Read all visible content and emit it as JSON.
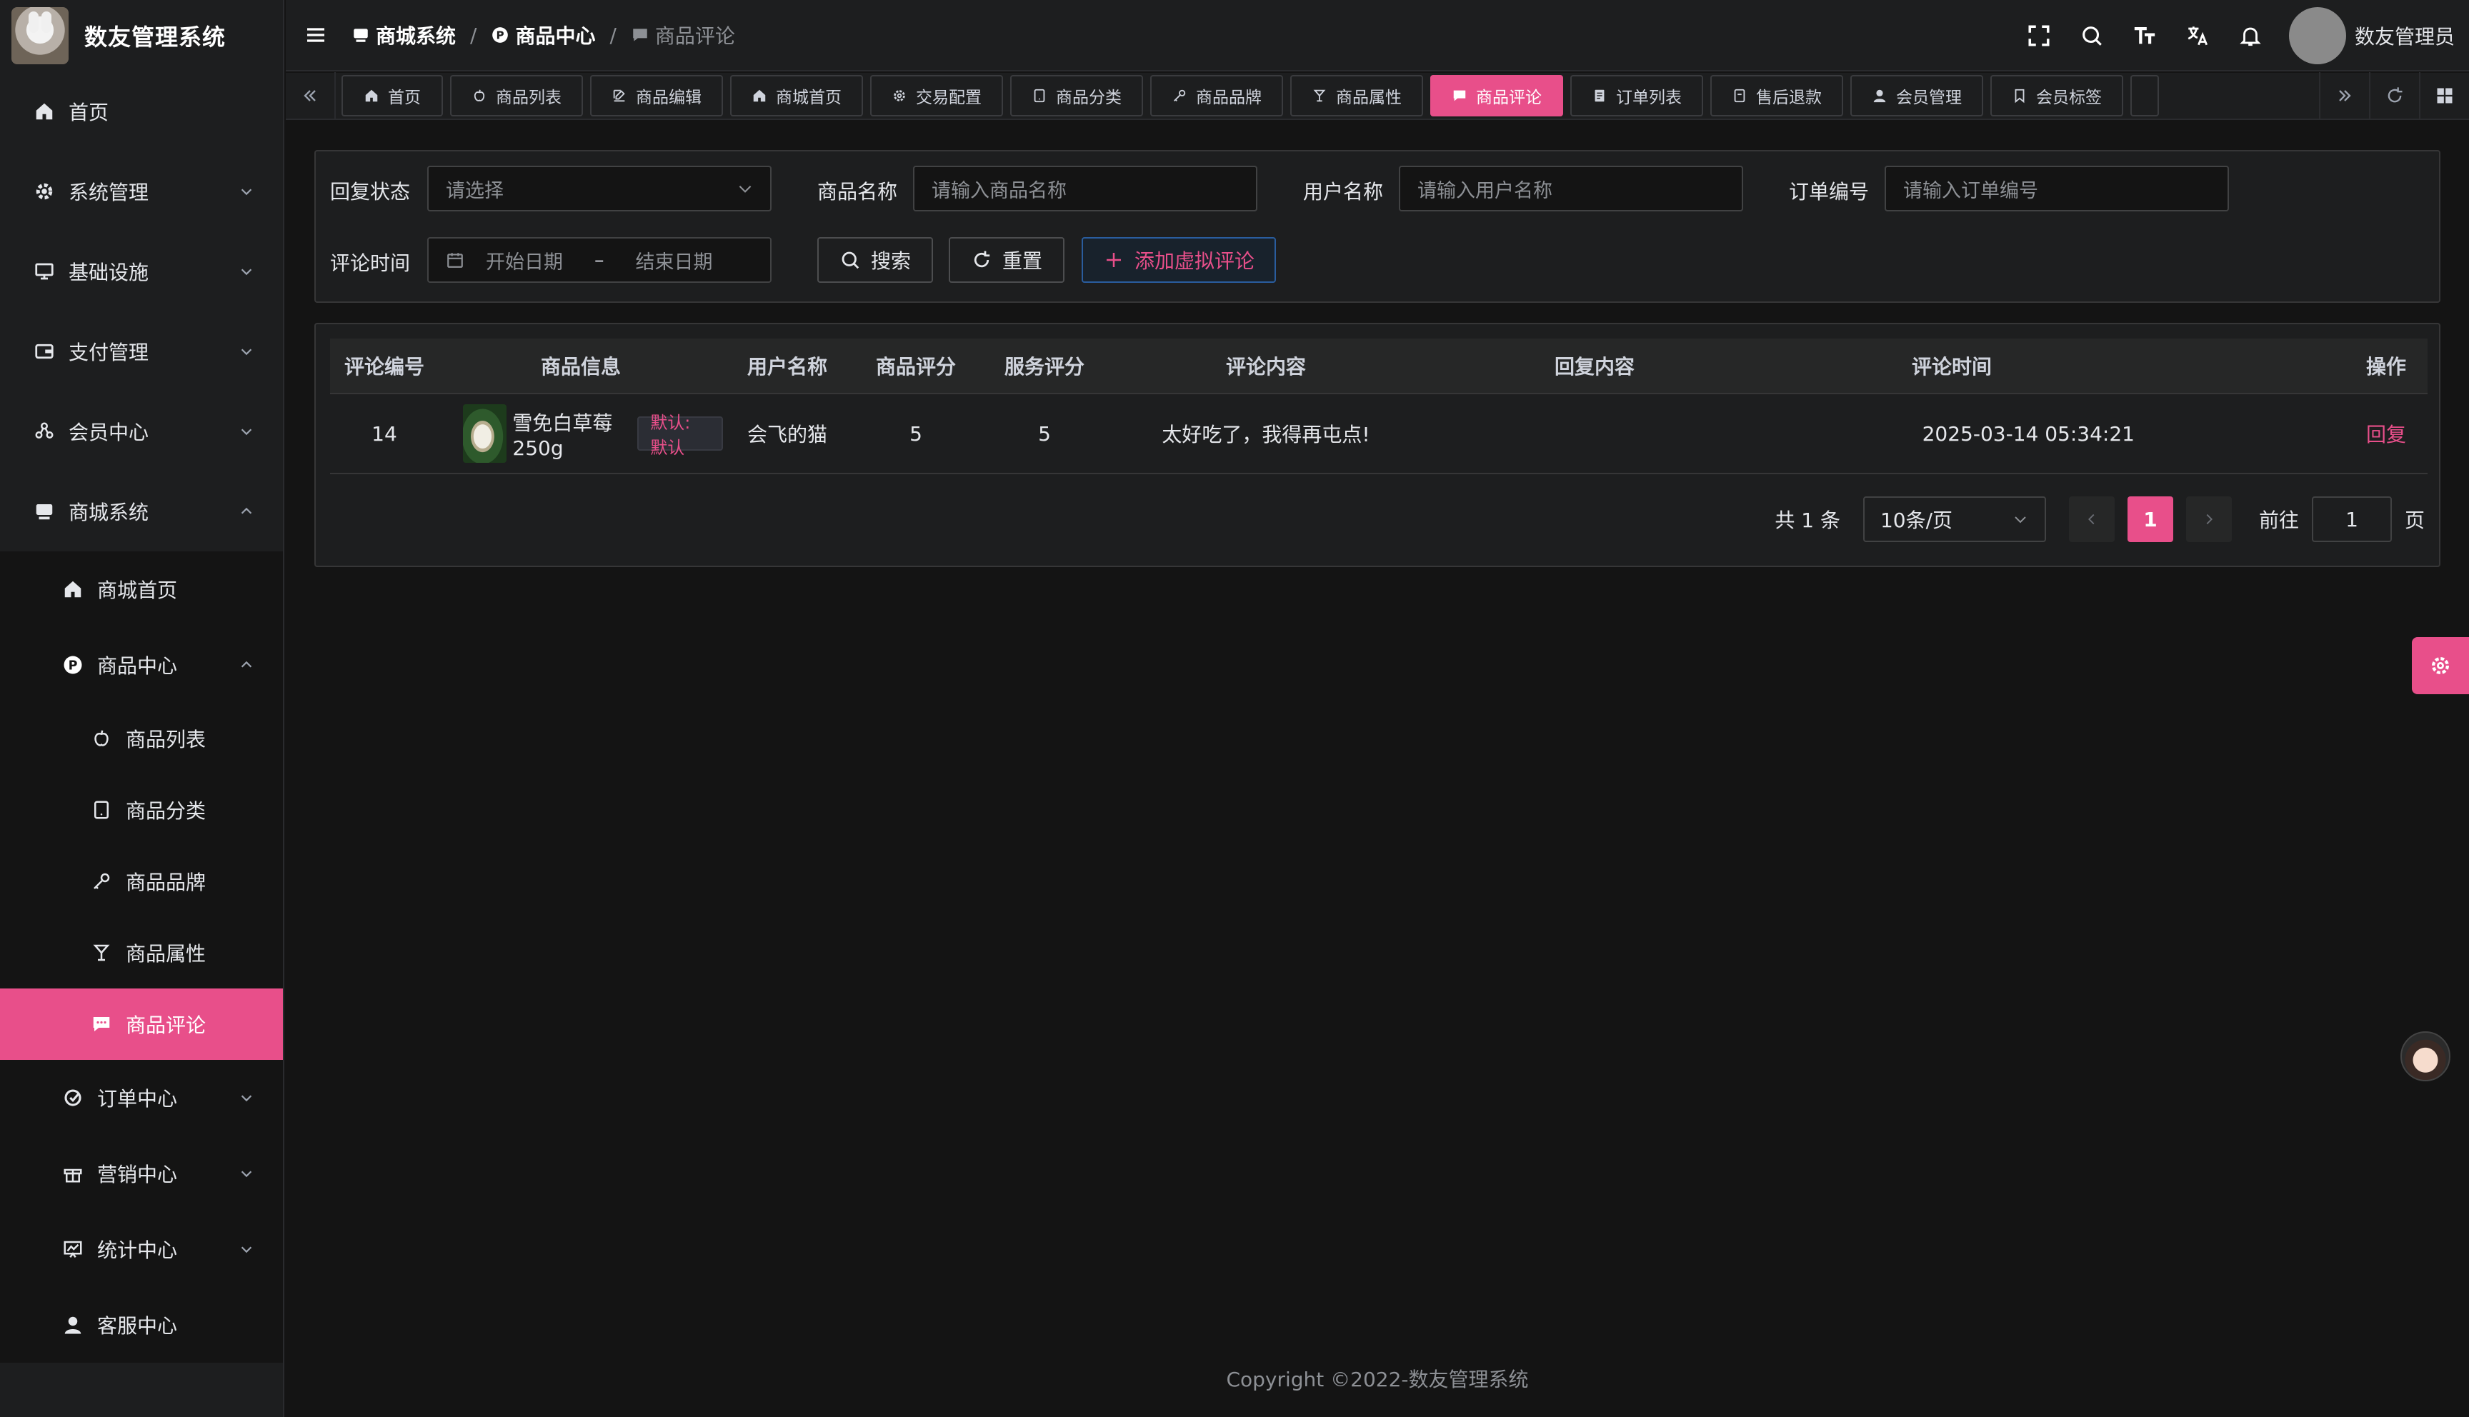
{
  "app": {
    "title": "数友管理系统"
  },
  "sidebar": {
    "items": [
      {
        "label": "首页",
        "icon": "home-icon"
      },
      {
        "label": "系统管理",
        "icon": "gear-icon"
      },
      {
        "label": "基础设施",
        "icon": "monitor-icon"
      },
      {
        "label": "支付管理",
        "icon": "wallet-icon"
      },
      {
        "label": "会员中心",
        "icon": "share-icon"
      },
      {
        "label": "商城系统",
        "icon": "shop-icon"
      }
    ],
    "shop_sub": [
      {
        "label": "商城首页",
        "icon": "home-icon"
      },
      {
        "label": "商品中心",
        "icon": "product-p-icon"
      }
    ],
    "product_sub": [
      {
        "label": "商品列表",
        "icon": "apple-icon"
      },
      {
        "label": "商品分类",
        "icon": "tablet-icon"
      },
      {
        "label": "商品品牌",
        "icon": "key-icon"
      },
      {
        "label": "商品属性",
        "icon": "goblet-icon"
      },
      {
        "label": "商品评论",
        "icon": "comment-icon"
      }
    ],
    "shop_tail": [
      {
        "label": "订单中心",
        "icon": "order-icon"
      },
      {
        "label": "营销中心",
        "icon": "gift-icon"
      },
      {
        "label": "统计中心",
        "icon": "chart-icon"
      },
      {
        "label": "客服中心",
        "icon": "user-icon"
      }
    ]
  },
  "header": {
    "breadcrumb": [
      "商城系统",
      "商品中心",
      "商品评论"
    ],
    "user_name": "数友管理员"
  },
  "tabs": [
    {
      "label": "首页",
      "icon": "home-icon"
    },
    {
      "label": "商品列表",
      "icon": "apple-icon"
    },
    {
      "label": "商品编辑",
      "icon": "edit-icon"
    },
    {
      "label": "商城首页",
      "icon": "home-icon"
    },
    {
      "label": "交易配置",
      "icon": "gear-icon"
    },
    {
      "label": "商品分类",
      "icon": "tablet-icon"
    },
    {
      "label": "商品品牌",
      "icon": "key-icon"
    },
    {
      "label": "商品属性",
      "icon": "goblet-icon"
    },
    {
      "label": "商品评论",
      "icon": "comment-icon",
      "active": true
    },
    {
      "label": "订单列表",
      "icon": "list-icon"
    },
    {
      "label": "售后退款",
      "icon": "refund-icon"
    },
    {
      "label": "会员管理",
      "icon": "user-icon"
    },
    {
      "label": "会员标签",
      "icon": "bookmark-icon"
    }
  ],
  "search": {
    "reply_status_label": "回复状态",
    "reply_status_placeholder": "请选择",
    "product_name_label": "商品名称",
    "product_name_placeholder": "请输入商品名称",
    "user_name_label": "用户名称",
    "user_name_placeholder": "请输入用户名称",
    "order_no_label": "订单编号",
    "order_no_placeholder": "请输入订单编号",
    "comment_time_label": "评论时间",
    "start_date_placeholder": "开始日期",
    "range_separator": "–",
    "end_date_placeholder": "结束日期",
    "search_button": "搜索",
    "reset_button": "重置",
    "add_button": "添加虚拟评论"
  },
  "table": {
    "columns": [
      "评论编号",
      "商品信息",
      "用户名称",
      "商品评分",
      "服务评分",
      "评论内容",
      "回复内容",
      "评论时间",
      "操作"
    ],
    "rows": [
      {
        "id": "14",
        "product_name": "雪免白草莓 250g",
        "sku_tag": "默认: 默认",
        "user_name": "会飞的猫",
        "product_score": "5",
        "service_score": "5",
        "content": "太好吃了，我得再屯点!",
        "reply": "",
        "time": "2025-03-14 05:34:21",
        "action": "回复"
      }
    ]
  },
  "pagination": {
    "total": "共 1 条",
    "page_size": "10条/页",
    "current_page": "1",
    "goto_label": "前往",
    "goto_value": "1",
    "page_suffix": "页"
  },
  "footer": {
    "copyright": "Copyright ©2022-数友管理系统"
  },
  "colors": {
    "accent": "#e84f8a",
    "background": "#141414",
    "panel": "#1d1e1f"
  }
}
